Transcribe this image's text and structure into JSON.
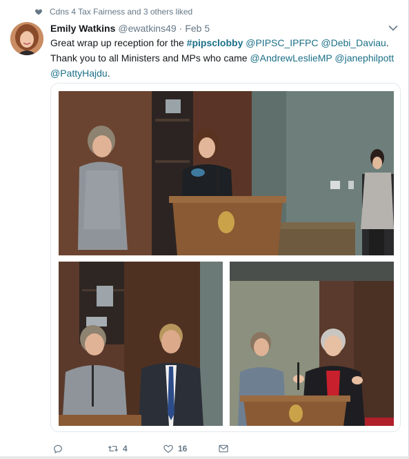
{
  "context": {
    "liked_text": "Cdns 4 Tax Fairness and 3 others liked",
    "icon": "heart-icon"
  },
  "tweet": {
    "author_name": "Emily Watkins",
    "author_handle": "@ewatkins49",
    "separator": "·",
    "time": "Feb 5",
    "text": {
      "p1": "Great wrap up reception for the ",
      "hashtag": "#pipsclobby",
      "p2": " ",
      "m1": "@PIPSC_IPFPC",
      "p3": " ",
      "m2": "@Debi_Daviau",
      "p4": ". Thank you to all Ministers and MPs who came ",
      "m3": "@AndrewLeslieMP",
      "p5": " ",
      "m4": "@janephilpott",
      "p6": " ",
      "m5": "@PattyHajdu",
      "p7": "."
    }
  },
  "actions": {
    "reply_icon": "reply-icon",
    "retweet_icon": "retweet-icon",
    "retweet_count": "4",
    "like_icon": "heart-outline-icon",
    "like_count": "16",
    "message_icon": "envelope-icon"
  },
  "colors": {
    "link": "#1b6f87",
    "meta": "#657786",
    "text": "#14171a"
  }
}
